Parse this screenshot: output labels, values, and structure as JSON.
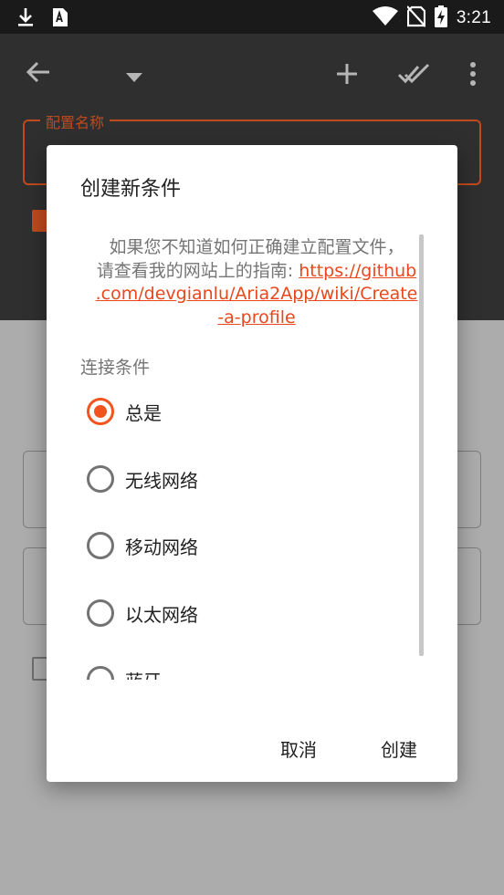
{
  "status_bar": {
    "time": "3:21",
    "icons": [
      "download-icon",
      "font-icon",
      "wifi-icon",
      "no-sim-icon",
      "battery-charging-icon"
    ]
  },
  "toolbar": {
    "icons": [
      "back-arrow-icon",
      "dropdown-arrow-icon",
      "add-icon",
      "done-all-icon",
      "more-vert-icon"
    ]
  },
  "background_form": {
    "profile_name_label": "配置名称"
  },
  "dialog": {
    "title": "创建新条件",
    "message_prefix": "如果您不知道如何正确建立配置文件，请查看我的网站上的指南: ",
    "message_link": "https://github.com/devgianlu/Aria2App/wiki/Create-a-profile",
    "link_lines": [
      "https://github",
      ".com/devgianlu/Aria2App/wiki/Create",
      "-a-profile"
    ],
    "message_line1": "如果您不知道如何正确建立配置文件，",
    "message_line2_prefix": "请查看我的网站上的指南: ",
    "section_label": "连接条件",
    "options": [
      {
        "label": "总是",
        "checked": true
      },
      {
        "label": "无线网络",
        "checked": false
      },
      {
        "label": "移动网络",
        "checked": false
      },
      {
        "label": "以太网络",
        "checked": false
      },
      {
        "label": "蓝牙",
        "checked": false
      }
    ],
    "cancel_label": "取消",
    "create_label": "创建"
  },
  "colors": {
    "accent": "#f2541f",
    "link": "#e8481d",
    "appbar": "#2f2f2f",
    "statusbar": "#1a1a1a",
    "scrim": "#acacac"
  }
}
